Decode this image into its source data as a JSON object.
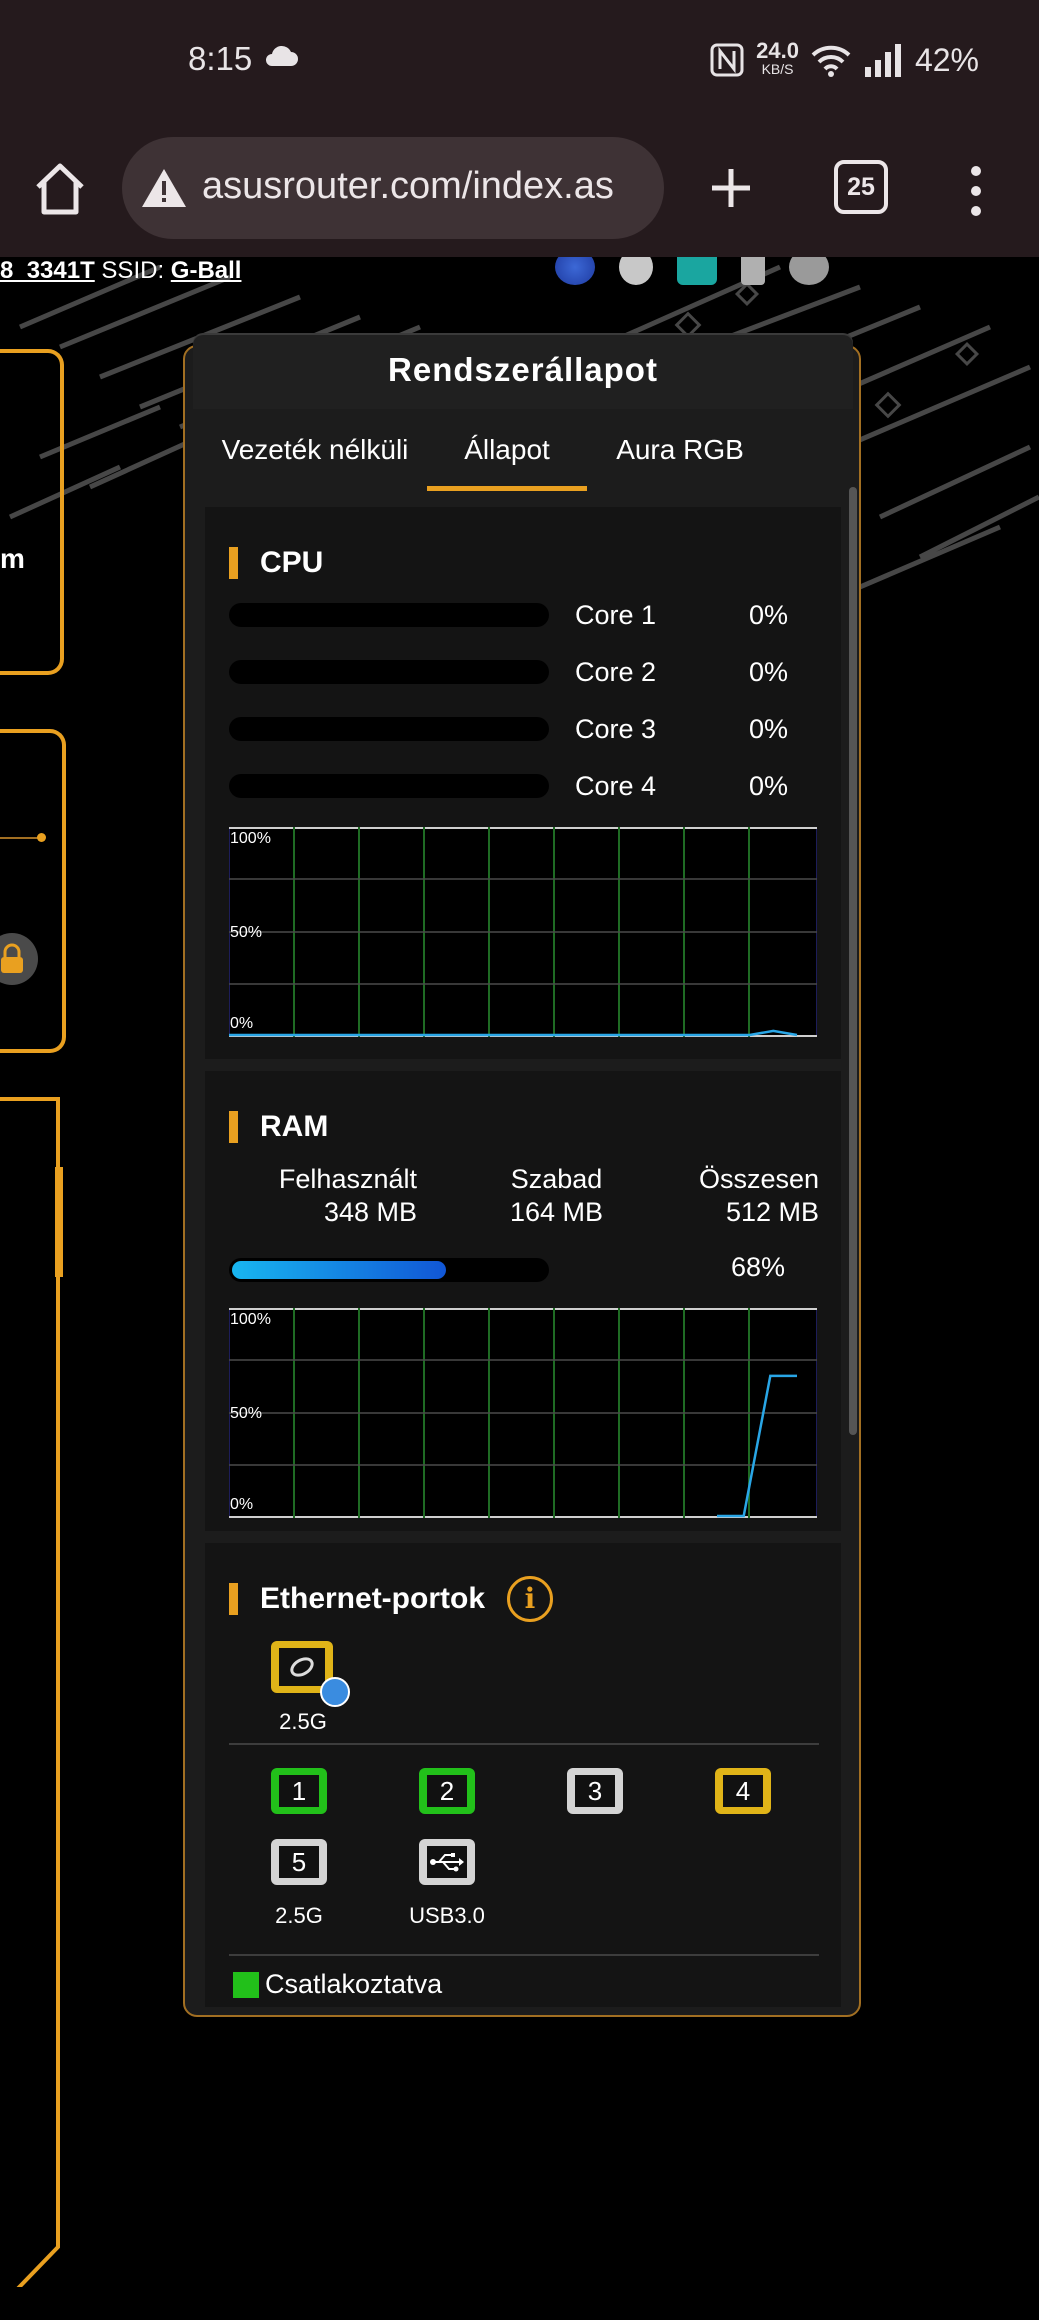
{
  "status_bar": {
    "time": "8:15",
    "speed_value": "24.0",
    "speed_unit": "KB/S",
    "battery": "42%"
  },
  "browser": {
    "url": "asusrouter.com/index.as",
    "tab_count": "25"
  },
  "router_header": {
    "network_suffix": "8_3341T",
    "ssid_label": "SSID:",
    "ssid_value": "G-Ball"
  },
  "left_cards": {
    "partial_text": "m"
  },
  "panel": {
    "title": "Rendszerállapot",
    "tabs": [
      {
        "label": "Vezeték nélküli",
        "active": false
      },
      {
        "label": "Állapot",
        "active": true
      },
      {
        "label": "Aura RGB",
        "active": false
      }
    ]
  },
  "cpu": {
    "title": "CPU",
    "cores": [
      {
        "name": "Core 1",
        "percent": "0%"
      },
      {
        "name": "Core 2",
        "percent": "0%"
      },
      {
        "name": "Core 3",
        "percent": "0%"
      },
      {
        "name": "Core 4",
        "percent": "0%"
      }
    ],
    "graph_labels": [
      "100%",
      "50%",
      "0%"
    ],
    "history_percent": [
      0,
      0,
      0,
      0,
      0,
      0,
      0,
      0,
      0,
      0,
      0,
      0,
      0,
      0,
      0,
      0,
      0,
      0,
      0,
      0,
      0,
      0,
      0,
      2,
      0
    ]
  },
  "ram": {
    "title": "RAM",
    "used_label": "Felhasznált",
    "used_value": "348 MB",
    "free_label": "Szabad",
    "free_value": "164 MB",
    "total_label": "Összesen",
    "total_value": "512 MB",
    "usage_percent_text": "68%",
    "usage_fraction": 0.68,
    "graph_labels": [
      "100%",
      "50%",
      "0%"
    ],
    "history_percent": [
      0,
      0,
      68,
      68
    ]
  },
  "ethernet": {
    "title": "Ethernet-portok",
    "info_glyph": "i",
    "wan_label": "2.5G",
    "ports": [
      {
        "number": "1",
        "state": "connected"
      },
      {
        "number": "2",
        "state": "connected"
      },
      {
        "number": "3",
        "state": "disconnected"
      },
      {
        "number": "4",
        "state": "warning"
      },
      {
        "number": "5",
        "state": "disconnected",
        "label": "2.5G"
      },
      {
        "number": "",
        "state": "disconnected",
        "label": "USB3.0",
        "icon": "usb-icon"
      }
    ],
    "legend_connected": "Csatlakoztatva"
  },
  "colors": {
    "accent": "#e9a020",
    "connected": "#22c01a",
    "warning": "#e0b418",
    "disconnected": "#d4d4d4",
    "ram_line": "#29a6e6",
    "grid": "#1f6b24"
  }
}
